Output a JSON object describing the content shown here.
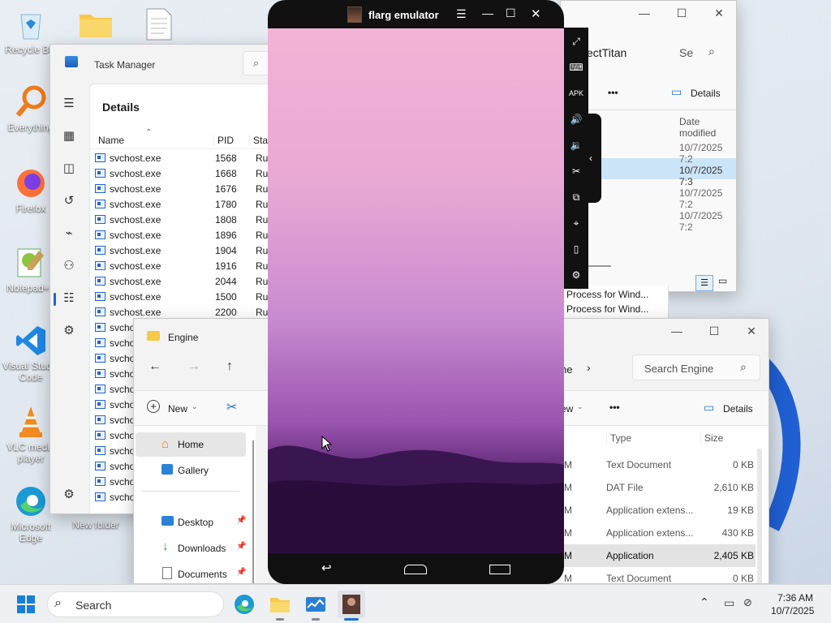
{
  "desktop": {
    "icons": [
      "Recycle Bin",
      "Everything",
      "Firefox",
      "Notepad++",
      "Visual Studio Code",
      "VLC media player",
      "Microsoft Edge",
      "New folder"
    ]
  },
  "task_manager": {
    "title": "Task Manager",
    "page_title": "Details",
    "columns": {
      "name": "Name",
      "pid": "PID",
      "status": "Stat"
    },
    "rows": [
      {
        "name": "svchost.exe",
        "pid": "1568",
        "status": "Run"
      },
      {
        "name": "svchost.exe",
        "pid": "1668",
        "status": "Run"
      },
      {
        "name": "svchost.exe",
        "pid": "1676",
        "status": "Run"
      },
      {
        "name": "svchost.exe",
        "pid": "1780",
        "status": "Run"
      },
      {
        "name": "svchost.exe",
        "pid": "1808",
        "status": "Run"
      },
      {
        "name": "svchost.exe",
        "pid": "1896",
        "status": "Run"
      },
      {
        "name": "svchost.exe",
        "pid": "1904",
        "status": "Run"
      },
      {
        "name": "svchost.exe",
        "pid": "1916",
        "status": "Run"
      },
      {
        "name": "svchost.exe",
        "pid": "2044",
        "status": "Run"
      },
      {
        "name": "svchost.exe",
        "pid": "1500",
        "status": "Run"
      },
      {
        "name": "svchost.exe",
        "pid": "2200",
        "status": "Run"
      },
      {
        "name": "svcho",
        "pid": "",
        "status": ""
      },
      {
        "name": "svcho",
        "pid": "",
        "status": ""
      },
      {
        "name": "svcho",
        "pid": "",
        "status": ""
      },
      {
        "name": "svcho",
        "pid": "",
        "status": ""
      },
      {
        "name": "svcho",
        "pid": "",
        "status": ""
      },
      {
        "name": "svcho",
        "pid": "",
        "status": ""
      },
      {
        "name": "svcho",
        "pid": "",
        "status": ""
      },
      {
        "name": "svcho",
        "pid": "",
        "status": ""
      },
      {
        "name": "svcho",
        "pid": "",
        "status": ""
      },
      {
        "name": "svcho",
        "pid": "",
        "status": ""
      },
      {
        "name": "svcho",
        "pid": "",
        "status": ""
      },
      {
        "name": "svcho",
        "pid": "",
        "status": ""
      }
    ],
    "bg_rows": [
      "Process for Wind...",
      "Process for Wind..."
    ]
  },
  "explorer_top": {
    "breadcrumb": "ectTitan",
    "search": "Se",
    "more": "•••",
    "details": "Details",
    "col_date": "Date modified",
    "dates": [
      "10/7/2025 7:2",
      "10/7/2025 7:3",
      "10/7/2025 7:2",
      "10/7/2025 7:2"
    ]
  },
  "explorer_engine": {
    "title": "Engine",
    "breadcrumb": "ne",
    "search_placeholder": "Search Engine",
    "new_label": "New",
    "view_partial": "ew",
    "more": "•••",
    "details": "Details",
    "nav": [
      "Home",
      "Gallery",
      "Desktop",
      "Downloads",
      "Documents"
    ],
    "col_type": "Type",
    "col_size": "Size",
    "rows": [
      {
        "m": "M",
        "type": "Text Document",
        "size": "0 KB"
      },
      {
        "m": "M",
        "type": "DAT File",
        "size": "2,610 KB"
      },
      {
        "m": "M",
        "type": "Application extens...",
        "size": "19 KB"
      },
      {
        "m": "M",
        "type": "Application extens...",
        "size": "430 KB"
      },
      {
        "m": "M",
        "type": "Application",
        "size": "2,405 KB"
      },
      {
        "m": "M",
        "type": "Text Document",
        "size": "0 KB"
      }
    ]
  },
  "emulator": {
    "title": "flarg emulator"
  },
  "taskbar": {
    "search": "Search",
    "time": "7:36 AM",
    "date": "10/7/2025"
  }
}
